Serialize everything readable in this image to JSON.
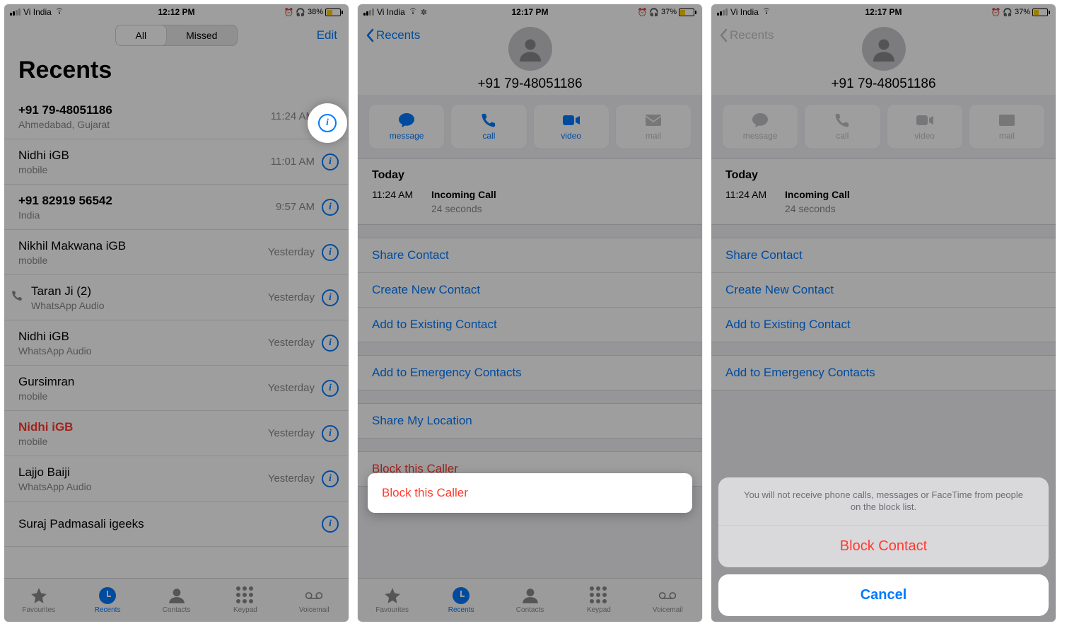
{
  "status": {
    "carrier": "Vi India",
    "time1": "12:12 PM",
    "time2": "12:17 PM",
    "time3": "12:17 PM",
    "battery1": "38%",
    "battery2": "37%",
    "battery3": "37%"
  },
  "screen1": {
    "seg_all": "All",
    "seg_missed": "Missed",
    "edit": "Edit",
    "title": "Recents",
    "calls": [
      {
        "title": "+91 79-48051186",
        "sub": "Ahmedabad, Gujarat",
        "time": "11:24 AM",
        "bold": true
      },
      {
        "title": "Nidhi iGB",
        "sub": "mobile",
        "time": "11:01 AM"
      },
      {
        "title": "+91 82919 56542",
        "sub": "India",
        "time": "9:57 AM",
        "bold": true
      },
      {
        "title": "Nikhil Makwana iGB",
        "sub": "mobile",
        "time": "Yesterday"
      },
      {
        "title": "Taran Ji (2)",
        "sub": "WhatsApp Audio",
        "time": "Yesterday",
        "outgoing": true
      },
      {
        "title": "Nidhi iGB",
        "sub": "WhatsApp Audio",
        "time": "Yesterday"
      },
      {
        "title": "Gursimran",
        "sub": "mobile",
        "time": "Yesterday"
      },
      {
        "title": "Nidhi iGB",
        "sub": "mobile",
        "time": "Yesterday",
        "missed": true
      },
      {
        "title": "Lajjo Baiji",
        "sub": "WhatsApp Audio",
        "time": "Yesterday"
      },
      {
        "title": "Suraj Padmasali igeeks",
        "sub": "",
        "time": ""
      }
    ]
  },
  "tabs": {
    "fav": "Favourites",
    "recents": "Recents",
    "contacts": "Contacts",
    "keypad": "Keypad",
    "voicemail": "Voicemail"
  },
  "detail": {
    "back": "Recents",
    "number": "+91 79-48051186",
    "act_message": "message",
    "act_call": "call",
    "act_video": "video",
    "act_mail": "mail",
    "today": "Today",
    "log_time": "11:24 AM",
    "log_type": "Incoming Call",
    "log_dur": "24 seconds",
    "share_contact": "Share Contact",
    "create_contact": "Create New Contact",
    "add_existing": "Add to Existing Contact",
    "emergency": "Add to Emergency Contacts",
    "share_location": "Share My Location",
    "block_caller": "Block this Caller"
  },
  "sheet": {
    "message": "You will not receive phone calls, messages or FaceTime from people on the block list.",
    "block": "Block Contact",
    "cancel": "Cancel"
  }
}
